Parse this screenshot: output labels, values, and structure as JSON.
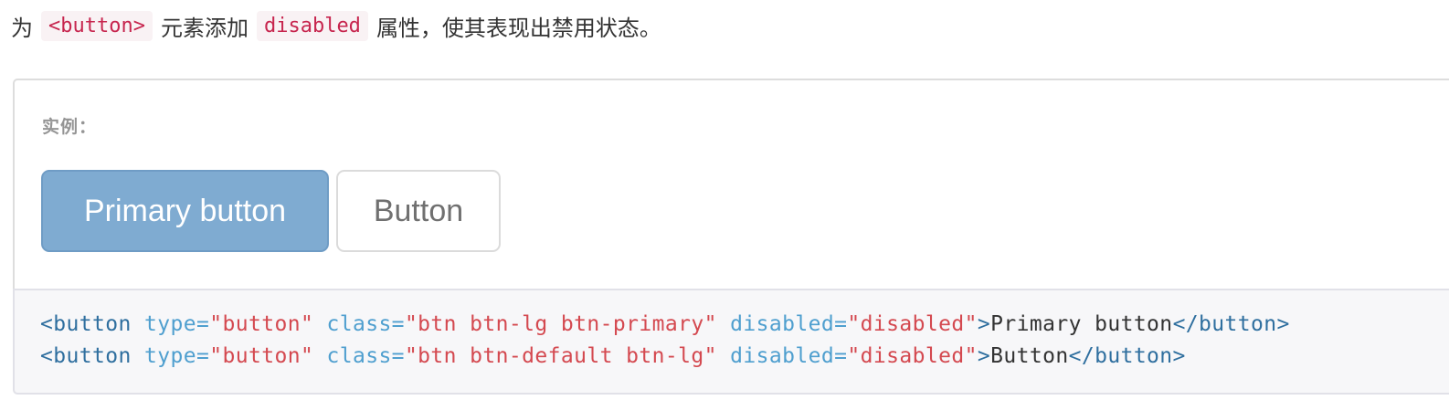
{
  "intro": {
    "prefix": "为",
    "code_button": "<button>",
    "middle": "元素添加",
    "code_disabled": "disabled",
    "suffix": "属性，使其表现出禁用状态。"
  },
  "example": {
    "label": "实例：",
    "primary_button_label": "Primary button",
    "default_button_label": "Button"
  },
  "code": {
    "line1": {
      "open_tag": "<button",
      "type_attr": " type=",
      "type_val": "\"button\"",
      "class_attr": " class=",
      "class_val": "\"btn btn-lg btn-primary\"",
      "disabled_attr": " disabled=",
      "disabled_val": "\"disabled\"",
      "close_bracket": ">",
      "text": "Primary button",
      "end_tag": "</button>"
    },
    "line2": {
      "open_tag": "<button",
      "type_attr": " type=",
      "type_val": "\"button\"",
      "class_attr": " class=",
      "class_val": "\"btn btn-default btn-lg\"",
      "disabled_attr": " disabled=",
      "disabled_val": "\"disabled\"",
      "close_bracket": ">",
      "text": "Button",
      "end_tag": "</button>"
    }
  },
  "colors": {
    "primary_disabled_bg": "#7fabd1",
    "inline_code_fg": "#c7254e",
    "inline_code_bg": "#f9f2f4",
    "code_tag": "#2f6f9f",
    "code_attr": "#4f9fcf",
    "code_string": "#d44950"
  }
}
